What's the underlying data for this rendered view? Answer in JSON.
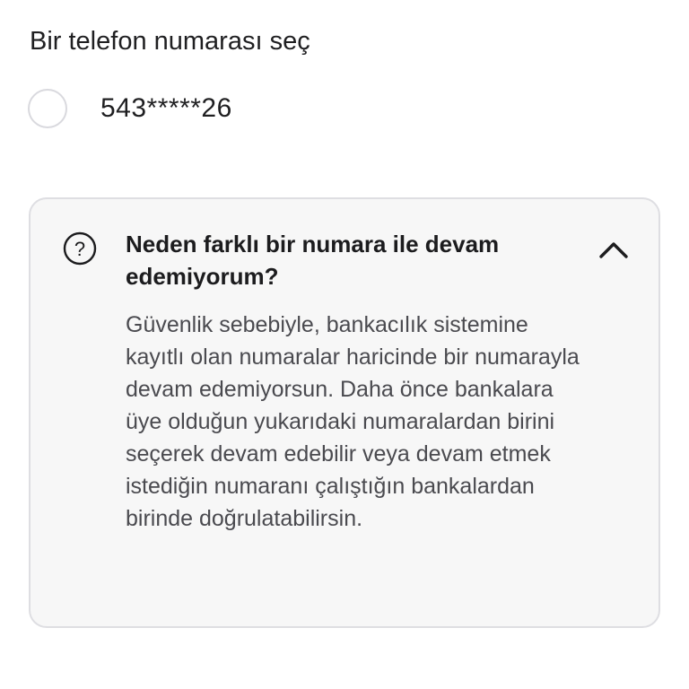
{
  "page": {
    "title": "Bir telefon numarası seç"
  },
  "phone_options": [
    {
      "number": "543*****26",
      "selected": false
    }
  ],
  "info_card": {
    "icon": "question-circle-icon",
    "title": "Neden farklı bir numara ile devam edemiyorum?",
    "expanded": true,
    "toggle_icon": "chevron-up-icon",
    "body": "Güvenlik sebebiyle, bankacılık sistemine kayıtlı olan numaralar haricinde bir numarayla devam edemiyorsun. Daha önce bankalara üye olduğun yukarıdaki numaralardan birini seçerek devam edebilir veya devam etmek istediğin numaranı çalıştığın bankalardan birinde doğrulatabilirsin."
  },
  "colors": {
    "card_background": "#f7f7f7",
    "card_border": "#dedee2",
    "body_text": "#4a4a4f",
    "title_text": "#1c1c1e",
    "radio_border": "#d9d9de"
  }
}
